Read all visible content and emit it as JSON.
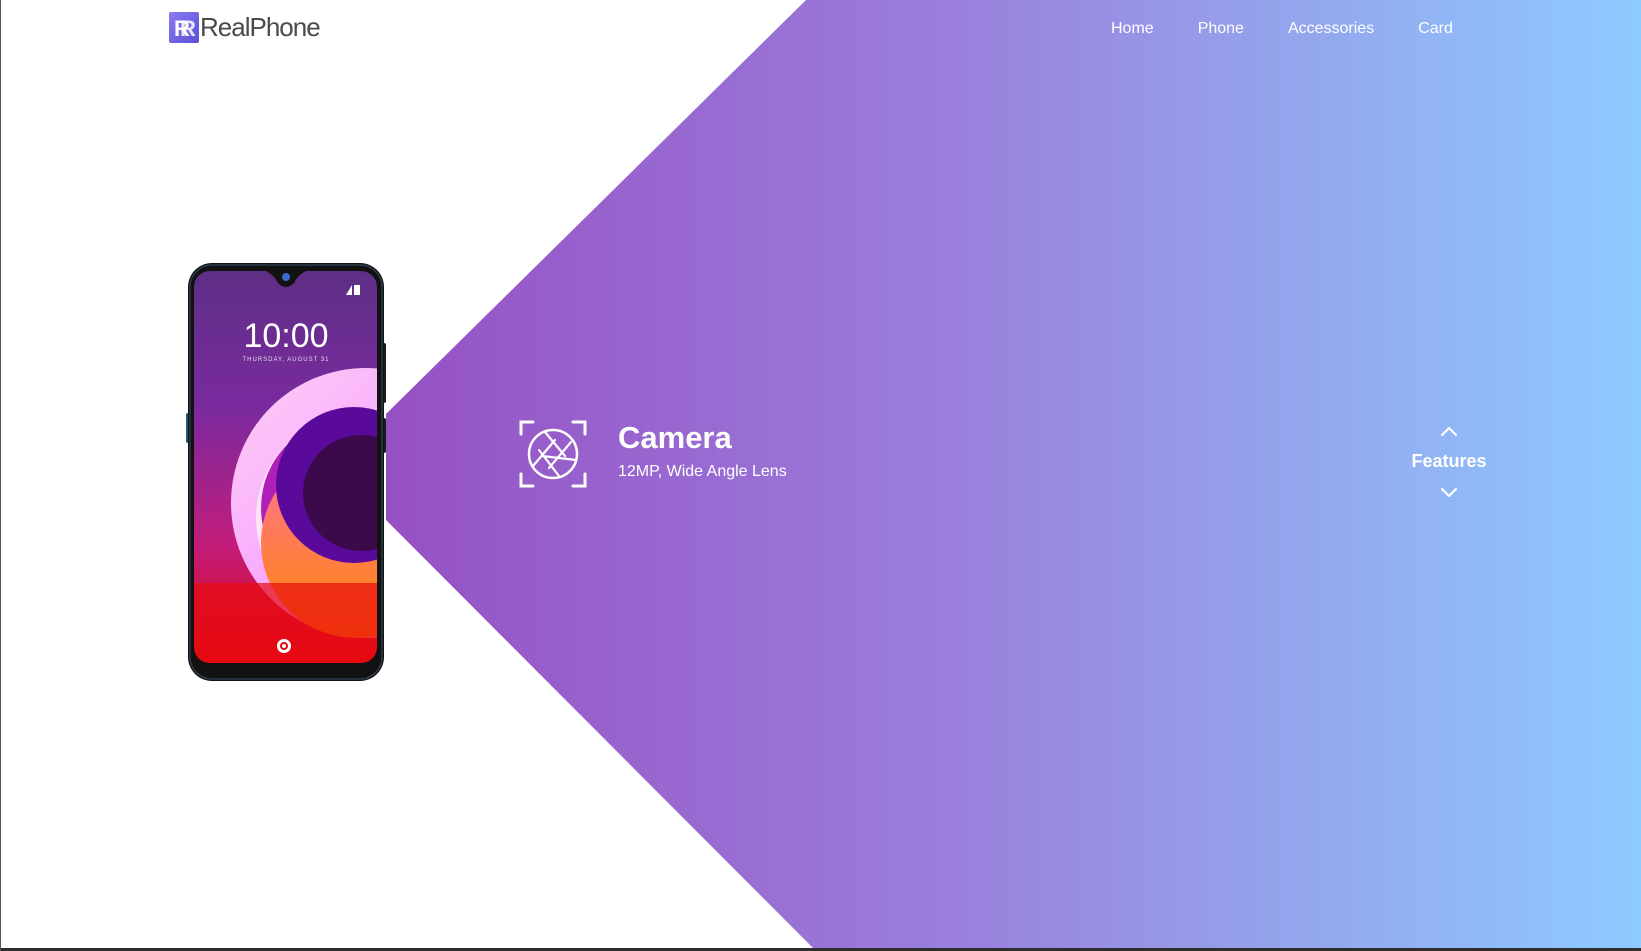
{
  "brand": {
    "mark": "R",
    "name": "RealPhone",
    "mark_gradient": [
      "#8b7cf0",
      "#5b4fd8"
    ]
  },
  "nav": {
    "items": [
      {
        "label": "Home"
      },
      {
        "label": "Phone"
      },
      {
        "label": "Accessories"
      },
      {
        "label": "Card"
      }
    ]
  },
  "phone": {
    "clock": "10:00",
    "date": "THURSDAY, AUGUST 31"
  },
  "feature": {
    "icon": "camera-aperture-icon",
    "title": "Camera",
    "description": "12MP, Wide Angle Lens"
  },
  "features_nav": {
    "label": "Features",
    "up_icon": "chevron-up-icon",
    "down_icon": "chevron-down-icon"
  },
  "colors": {
    "gradient_start": "#9650c4",
    "gradient_mid": "#9a7fdc",
    "gradient_end": "#8ecbff",
    "text_on_gradient": "#ffffff",
    "logo_text": "#4a4a4a"
  }
}
